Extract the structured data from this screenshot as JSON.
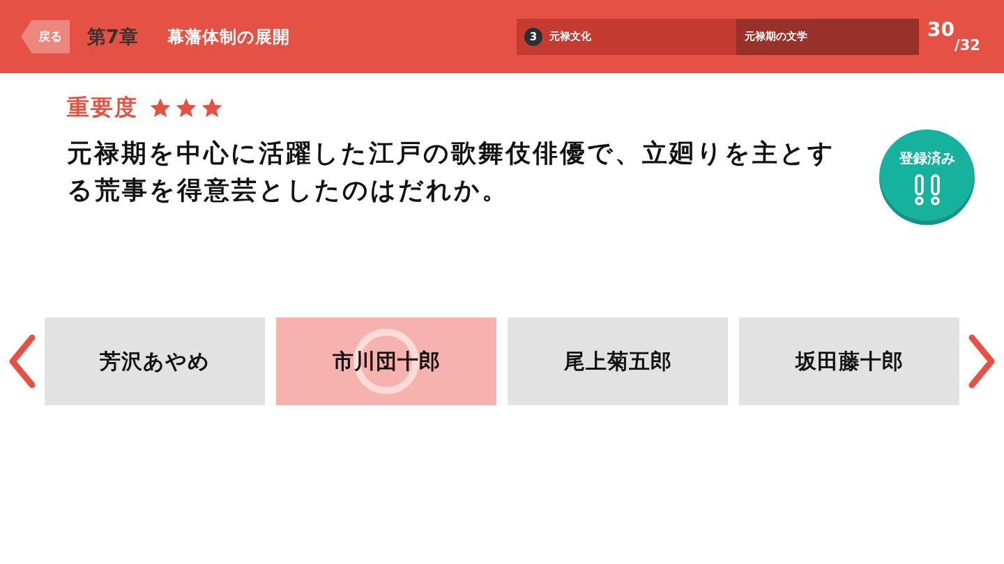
{
  "header": {
    "back_button": "戻る",
    "chapter": "第7章",
    "title": "幕藩体制の展開",
    "breadcrumb": {
      "section_number": "3",
      "section": "元禄文化",
      "topic": "元禄期の文学"
    },
    "progress": {
      "current": "30",
      "total": "/32"
    }
  },
  "question": {
    "importance_label": "重要度",
    "stars": 3,
    "text": "元禄期を中心に活躍した江戸の歌舞伎俳優で、立廻りを主とする荒事を得意芸としたのはだれか。",
    "registered_button": "登録済み"
  },
  "choices": [
    {
      "label": "芳沢あやめ",
      "selected": false
    },
    {
      "label": "市川団十郎",
      "selected": true
    },
    {
      "label": "尾上菊五郎",
      "selected": false
    },
    {
      "label": "坂田藤十郎",
      "selected": false
    }
  ]
}
